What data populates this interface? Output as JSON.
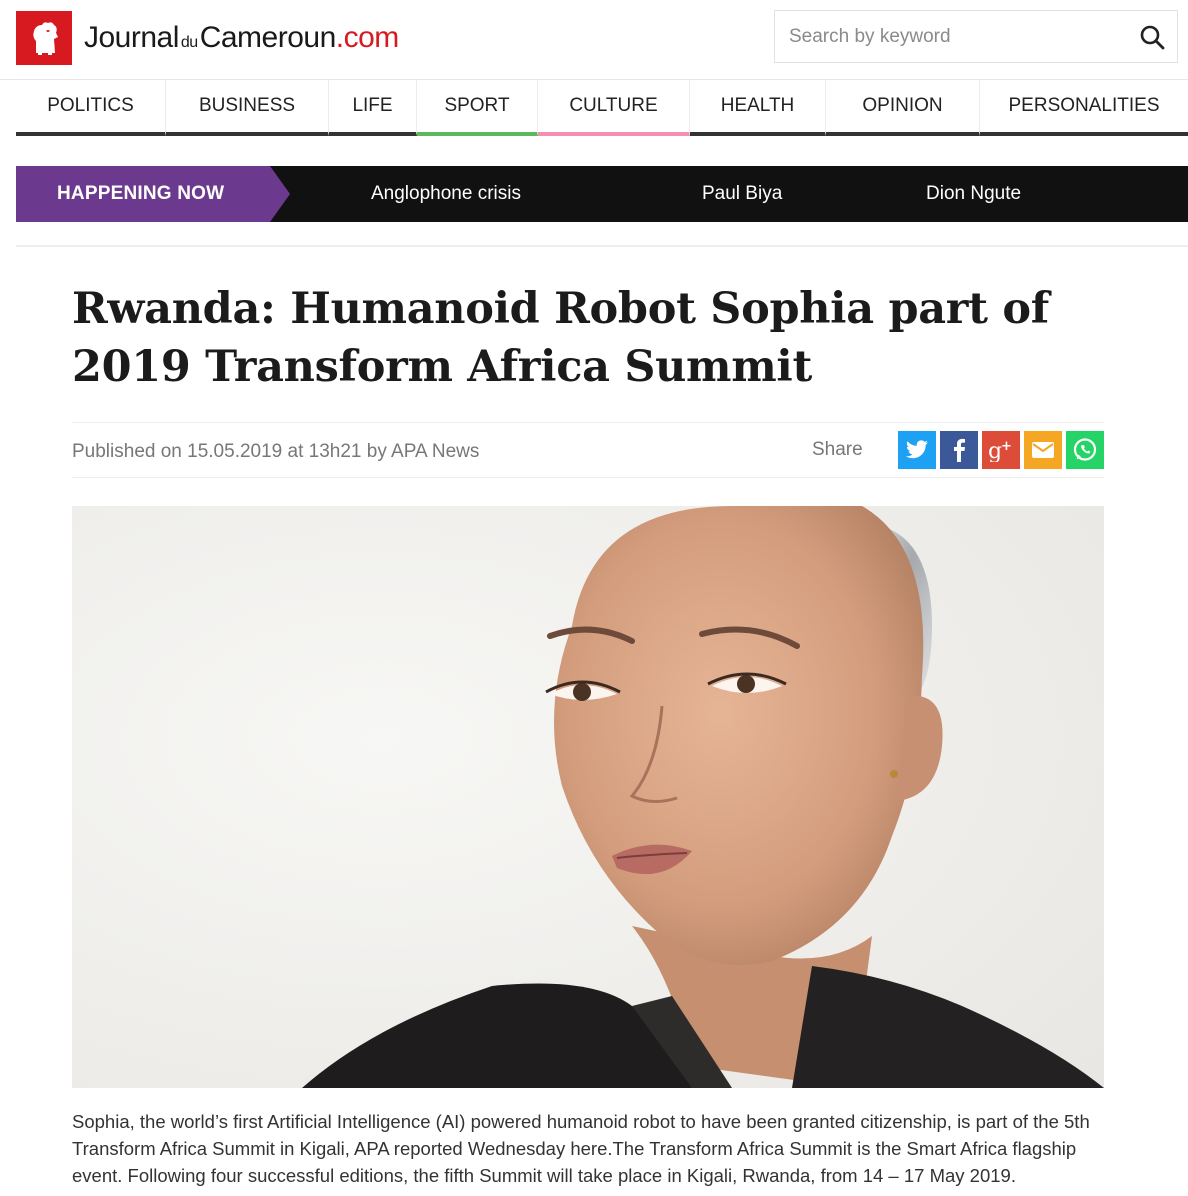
{
  "site": {
    "logo": {
      "part1": "Journal",
      "part2": "du",
      "part3": "Cameroun",
      "part4": ".com",
      "brand_color": "#d71920"
    },
    "search": {
      "placeholder": "Search by keyword",
      "value": "",
      "icon": "search-icon"
    }
  },
  "nav": {
    "items": [
      {
        "label": "POLITICS",
        "accent": "#333333"
      },
      {
        "label": "BUSINESS",
        "accent": "#333333"
      },
      {
        "label": "LIFE",
        "accent": "#333333"
      },
      {
        "label": "SPORT",
        "accent": "#5cb85c"
      },
      {
        "label": "CULTURE",
        "accent": "#f48fb1"
      },
      {
        "label": "HEALTH",
        "accent": "#333333"
      },
      {
        "label": "OPINION",
        "accent": "#333333"
      },
      {
        "label": "PERSONALITIES",
        "accent": "#333333"
      }
    ]
  },
  "happening_now": {
    "label": "HAPPENING NOW",
    "color": "#6b3a8e",
    "links": [
      "Anglophone crisis",
      "Paul Biya",
      "Dion Ngute"
    ]
  },
  "article": {
    "title": "Rwanda: Humanoid Robot Sophia part of 2019 Transform Africa Summit",
    "published": "Published on 15.05.2019 at 13h21 by APA News",
    "share_label": "Share",
    "share_buttons": [
      {
        "icon": "twitter-icon",
        "color": "#1da1f2"
      },
      {
        "icon": "facebook-icon",
        "color": "#3b5998"
      },
      {
        "icon": "google-plus-icon",
        "color": "#dd4b39"
      },
      {
        "icon": "email-icon",
        "color": "#f5a623"
      },
      {
        "icon": "whatsapp-icon",
        "color": "#25d366"
      }
    ],
    "body": "Sophia, the world’s first Artificial Intelligence (AI) powered humanoid robot to have been granted citizenship, is part of the 5th Transform Africa Summit in Kigali, APA reported Wednesday here.The  Transform Africa Summit is the Smart Africa flagship event. Following  four successful editions, the fifth Summit will take place in Kigali,  Rwanda, from 14 – 17 May 2019."
  }
}
